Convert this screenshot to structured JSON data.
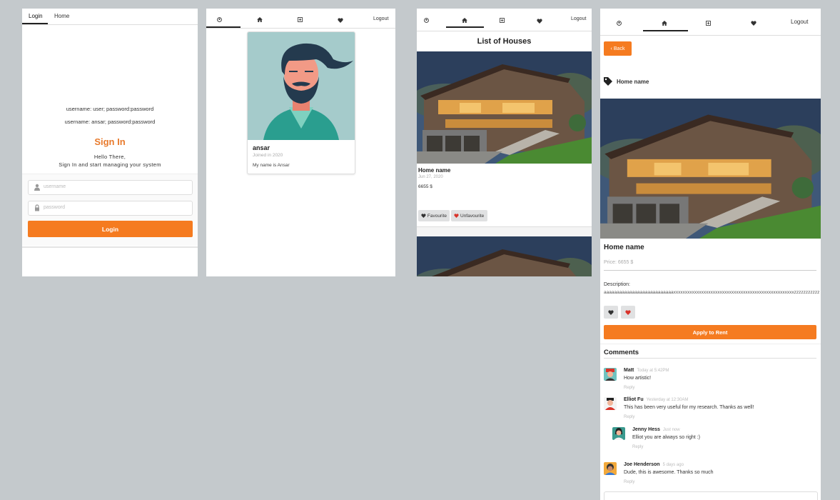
{
  "login_panel": {
    "tabs": [
      {
        "label": "Login"
      },
      {
        "label": "Home"
      }
    ],
    "credentials": [
      "username: user; password:password",
      "username: ansar; password:password"
    ],
    "title": "Sign In",
    "greeting": "Hello There,",
    "subtitle": "Sign In and start managing your system",
    "username_placeholder": "username",
    "password_placeholder": "password",
    "login_button": "Login"
  },
  "profile_panel": {
    "nav": {
      "logout": "Logout"
    },
    "name": "ansar",
    "joined": "Joined in 2020",
    "bio": "My name is Ansar"
  },
  "list_panel": {
    "nav": {
      "logout": "Logout"
    },
    "title": "List of Houses",
    "houses": [
      {
        "name": "Home name",
        "date": "Jun 27, 2020",
        "price": "6655 $"
      }
    ],
    "favourite_button": "Favourite",
    "unfavourite_button": "Unfavourite"
  },
  "detail_panel": {
    "nav": {
      "logout": "Logout"
    },
    "back_button": "Back",
    "tag_title": "Home name",
    "name": "Home name",
    "price": "Price: 6655 $",
    "description_label": "Description:",
    "description": "aaaaaaaaaaaaaaaaaaaaaaaaaaaxxxxxxxxxxxxxxxxxxxxxxxxxxxxxxxxxxxxxxxxxxxxxxxxxxxxzzzzzzzzzzz",
    "rent_button": "Apply to Rent",
    "comments_heading": "Comments",
    "comments": [
      {
        "author": "Matt",
        "time": "Today at 5:42PM",
        "text": "How artistic!",
        "reply": "Reply"
      },
      {
        "author": "Elliot Fu",
        "time": "Yesterday at 12:30AM",
        "text": "This has been very useful for my research. Thanks as well!",
        "reply": "Reply"
      },
      {
        "author": "Jenny Hess",
        "time": "Just now",
        "text": "Elliot you are always so right :)",
        "reply": "Reply"
      },
      {
        "author": "Joe Henderson",
        "time": "5 days ago",
        "text": "Dude, this is awesome. Thanks so much",
        "reply": "Reply"
      }
    ]
  },
  "colors": {
    "accent": "#f57b20",
    "heading_accent": "#e87a2c",
    "background": "#c4c9cc"
  }
}
